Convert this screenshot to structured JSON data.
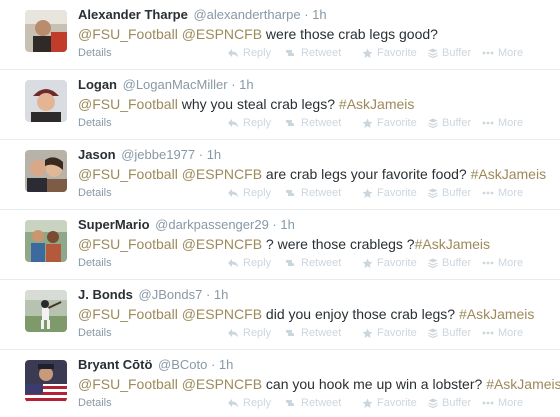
{
  "colors": {
    "link": "#9c8a5b",
    "text": "#292f33",
    "muted": "#8899a6",
    "action": "#ccd6dd",
    "divider": "#e6ecf0"
  },
  "labels": {
    "details": "Details",
    "reply": "Reply",
    "retweet": "Retweet",
    "favorite": "Favorite",
    "buffer": "Buffer",
    "more": "More"
  },
  "tweets": [
    {
      "name": "Alexander Tharpe",
      "handle": "@alexandertharpe",
      "time": "1h",
      "mention1": "@FSU_Football",
      "mention2": "@ESPNCFB",
      "text": " were those crab legs good?",
      "hashtag": ""
    },
    {
      "name": "Logan",
      "handle": "@LoganMacMiller",
      "time": "1h",
      "mention1": "@FSU_Football",
      "mention2": "",
      "text": " why you steal crab legs? ",
      "hashtag": "#AskJameis"
    },
    {
      "name": "Jason",
      "handle": "@jebbe1977",
      "time": "1h",
      "mention1": "@FSU_Football",
      "mention2": "@ESPNCFB",
      "text": " are crab legs your favorite food? ",
      "hashtag": "#AskJameis"
    },
    {
      "name": "SuperMario",
      "handle": "@darkpassenger29",
      "time": "1h",
      "mention1": "@FSU_Football",
      "mention2": "@ESPNCFB",
      "text": " ? were those crablegs ?",
      "hashtag": "#AskJameis"
    },
    {
      "name": "J. Bonds",
      "handle": "@JBonds7",
      "time": "1h",
      "mention1": "@FSU_Football",
      "mention2": "@ESPNCFB",
      "text": " did you enjoy those crab legs? ",
      "hashtag": "#AskJameis"
    },
    {
      "name": "Bryant Cōtö",
      "handle": "@BCoto",
      "time": "1h",
      "mention1": "@FSU_Football",
      "mention2": "@ESPNCFB",
      "text": " can you hook me up win a lobster? ",
      "hashtag": "#AskJameis"
    }
  ]
}
